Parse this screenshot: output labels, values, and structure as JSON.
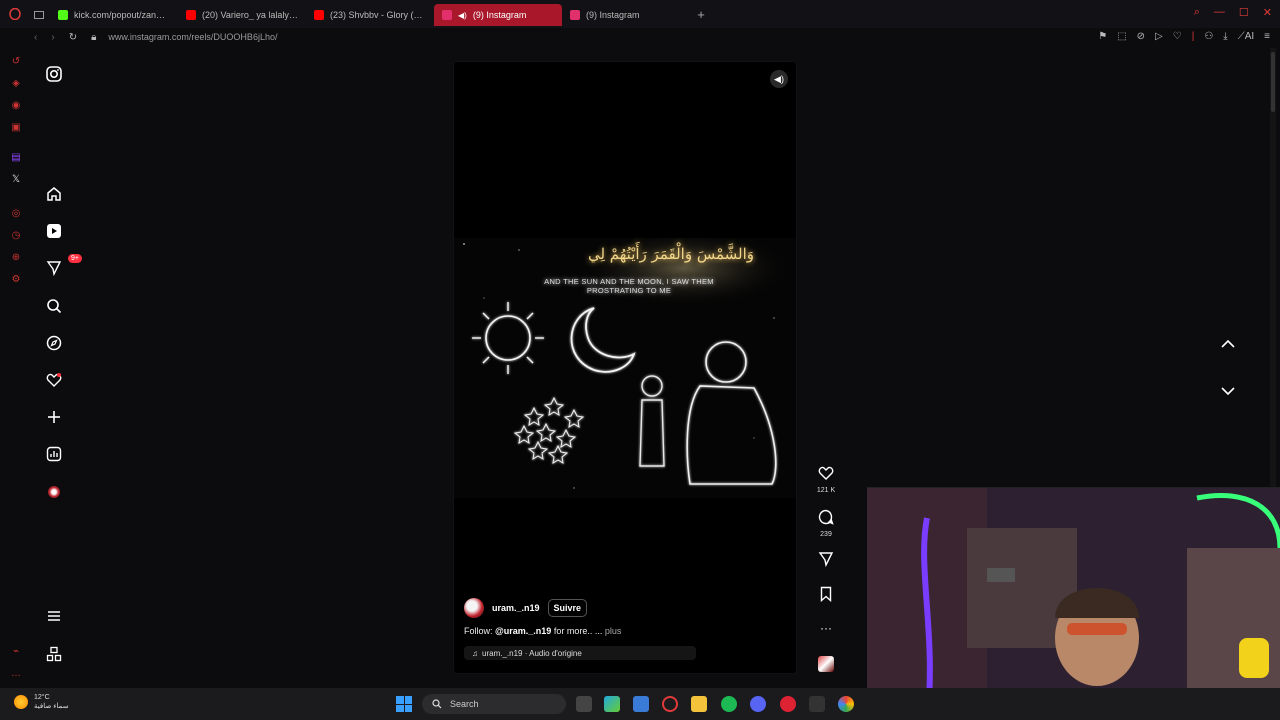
{
  "browser": {
    "tabs": [
      {
        "title": "kick.com/popout/zanoun...",
        "color": "#53fc18",
        "active": false
      },
      {
        "title": "(20) Variero_ ya lalaly (...",
        "color": "#ff0000",
        "active": false
      },
      {
        "title": "(23) Shvbbv - Glory (Offic",
        "color": "#ff0000",
        "active": false
      },
      {
        "title": "(9) Instagram",
        "color": "#e1306c",
        "active": true
      },
      {
        "title": "(9) Instagram",
        "color": "#e1306c",
        "active": false
      }
    ],
    "url": "www.instagram.com/reels/DUOOHB6jLho/"
  },
  "instagram": {
    "sidebar_badge": "9+",
    "reel": {
      "arabic_text": "وَالشَّمْسَ وَالْقَمَرَ رَأَيْتُهُمْ لِي",
      "overlay_text": "AND THE SUN AND THE MOON, I SAW THEM PROSTRATING TO ME",
      "username": "uram._.n19",
      "follow_label": "Suivre",
      "caption_prefix": "Follow: ",
      "caption_handle": "@uram._.n19",
      "caption_suffix": " for more.. ...",
      "caption_more": "plus",
      "audio": "uram._.n19 · Audio d'origine"
    },
    "actions": {
      "likes": "121 K",
      "comments": "239"
    }
  },
  "taskbar": {
    "temperature": "12°C",
    "weather_desc": "سماء صافية",
    "search_label": "Search"
  }
}
